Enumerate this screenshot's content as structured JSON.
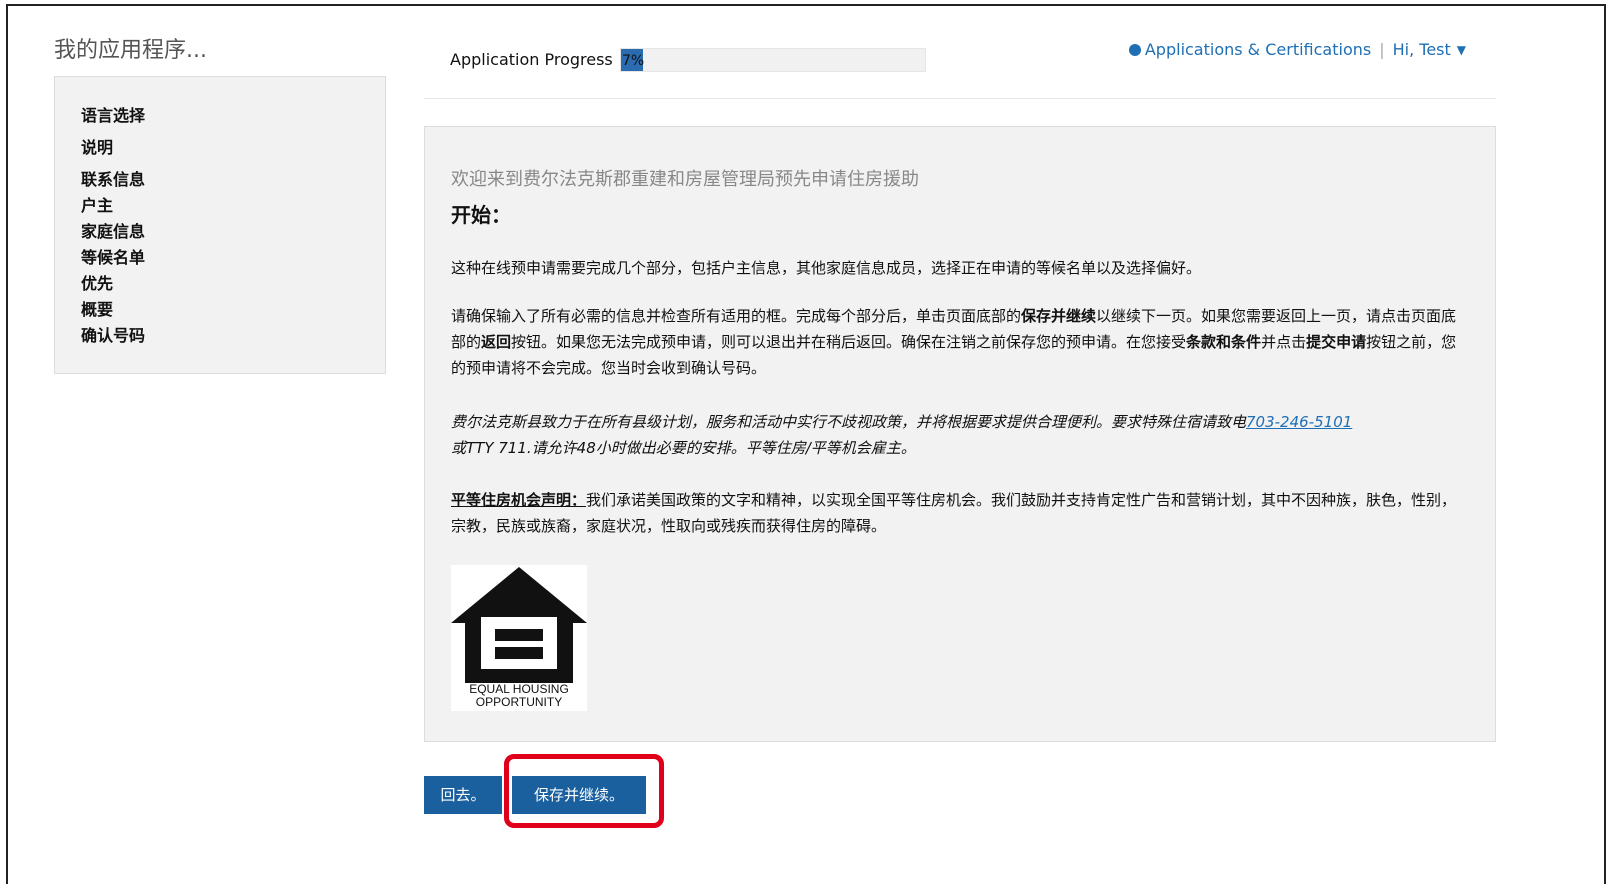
{
  "sidebar": {
    "title": "我的应用程序...",
    "items": [
      {
        "label": "语言选择"
      },
      {
        "label": "说明"
      },
      {
        "label": "联系信息"
      },
      {
        "label": "户主"
      },
      {
        "label": "家庭信息"
      },
      {
        "label": "等候名单"
      },
      {
        "label": "优先"
      },
      {
        "label": "概要"
      },
      {
        "label": "确认号码"
      }
    ]
  },
  "progress": {
    "label": "Application Progress",
    "value_text": "7%",
    "value": 0.07
  },
  "topnav": {
    "link": "Applications & Certifications",
    "user": "Hi, Test"
  },
  "main": {
    "welcome": "欢迎来到费尔法克斯郡重建和房屋管理局预先申请住房援助",
    "heading": "开始：",
    "p1": "这种在线预申请需要完成几个部分，包括户主信息，其他家庭信息成员，选择正在申请的等候名单以及选择偏好。",
    "p2_a": "请确保输入了所有必需的信息并检查所有适用的框。完成每个部分后，单击页面底部的",
    "p2_b": "保存并继续",
    "p2_c": "以继续下一页。如果您需要返回上一页，请点击页面底部的",
    "p2_d": "返回",
    "p2_e": "按钮。如果您无法完成预申请，则可以退出并在稍后返回。确保在注销之前保存您的预申请。在您接受",
    "p2_f": "条款和条件",
    "p2_g": "并点击",
    "p2_h": "提交申请",
    "p2_i": "按钮之前，您的预申请将不会完成。您当时会收到确认号码。",
    "p3_a": "费尔法克斯县致力于在所有县级计划，服务和活动中实行不歧视政策，并将根据要求提供合理便利。要求特殊住宿请致电",
    "p3_phone": "703-246-5101",
    "p3_b": "或TTY 711.请允许48小时做出必要的安排。平等住房/平等机会雇主。",
    "p4_title": "平等住房机会声明：",
    "p4_body": "我们承诺美国政策的文字和精神，以实现全国平等住房机会。我们鼓励并支持肯定性广告和营销计划，其中不因种族，肤色，性别，宗教，民族或族裔，家庭状况，性取向或残疾而获得住房的障碍。",
    "logo_text_1": "EQUAL HOUSING",
    "logo_text_2": "OPPORTUNITY"
  },
  "buttons": {
    "back": "回去。",
    "save": "保存并继续。"
  },
  "colors": {
    "primary": "#1a5f9e",
    "link": "#1f6fb5",
    "highlight": "#e0001a"
  }
}
